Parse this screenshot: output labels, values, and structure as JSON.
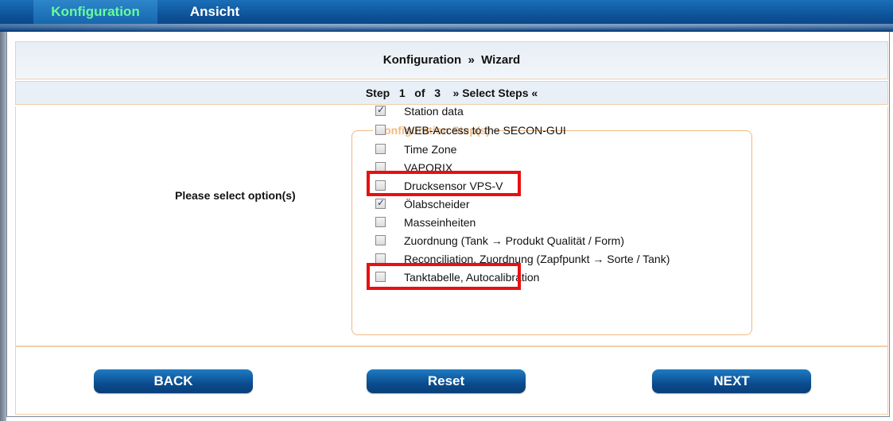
{
  "tabs": [
    {
      "label": "Konfiguration",
      "active": true
    },
    {
      "label": "Ansicht",
      "active": false
    }
  ],
  "header": {
    "breadcrumb_part1": "Konfiguration",
    "breadcrumb_sep": "»",
    "breadcrumb_part2": "Wizard"
  },
  "step": {
    "label": "Step",
    "current": "1",
    "of": "of",
    "total": "3",
    "title": "» Select Steps «"
  },
  "prompt": "Please select option(s)",
  "fieldset_legend": "Configuration Step(s)",
  "options": [
    {
      "label": "Station data",
      "checked": true
    },
    {
      "label": "WEB-Access to the SECON-GUI",
      "checked": false
    },
    {
      "label": "Time Zone",
      "checked": false
    },
    {
      "label": "VAPORIX",
      "checked": false
    },
    {
      "label": "Drucksensor VPS-V",
      "checked": false
    },
    {
      "label": "Ölabscheider",
      "checked": true
    },
    {
      "label": "Masseinheiten",
      "checked": false
    },
    {
      "label": "Zuordnung (Tank → Produkt Qualität / Form)",
      "checked": false
    },
    {
      "label": "Reconciliation,      Zuordnung (Zapfpunkt → Sorte / Tank)",
      "checked": false
    },
    {
      "label": "Tanktabelle,      Autocalibration",
      "checked": false
    }
  ],
  "buttons": {
    "back": "BACK",
    "reset": "Reset",
    "next": "NEXT"
  },
  "colors": {
    "accent_blue": "#0d4f95",
    "active_tab_text": "#66ff99",
    "legend_orange": "#f0b880",
    "highlight_red": "#e81010"
  }
}
